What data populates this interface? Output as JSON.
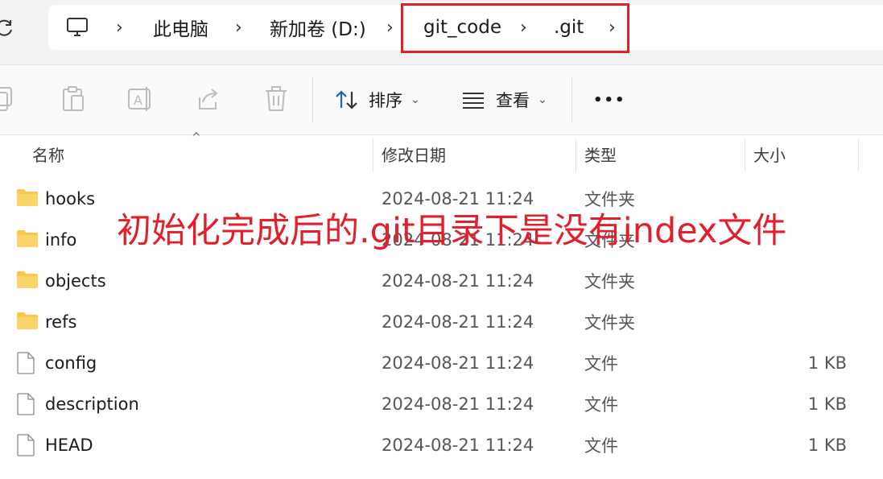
{
  "address_bar": {
    "items": [
      "此电脑",
      "新加卷 (D:)",
      "git_code",
      ".git"
    ],
    "computer_icon": "computer-icon",
    "refresh_icon": "refresh-icon"
  },
  "toolbar": {
    "sort_label": "排序",
    "view_label": "查看",
    "more_label": "•••"
  },
  "columns": {
    "name": "名称",
    "date_modified": "修改日期",
    "type": "类型",
    "size": "大小"
  },
  "files": [
    {
      "name": "hooks",
      "date": "2024-08-21 11:24",
      "type": "文件夹",
      "size": "",
      "icon": "folder-icon"
    },
    {
      "name": "info",
      "date": "2024-08-21 11:24",
      "type": "文件夹",
      "size": "",
      "icon": "folder-icon"
    },
    {
      "name": "objects",
      "date": "2024-08-21 11:24",
      "type": "文件夹",
      "size": "",
      "icon": "folder-icon"
    },
    {
      "name": "refs",
      "date": "2024-08-21 11:24",
      "type": "文件夹",
      "size": "",
      "icon": "folder-icon"
    },
    {
      "name": "config",
      "date": "2024-08-21 11:24",
      "type": "文件",
      "size": "1 KB",
      "icon": "file-icon"
    },
    {
      "name": "description",
      "date": "2024-08-21 11:24",
      "type": "文件",
      "size": "1 KB",
      "icon": "file-icon"
    },
    {
      "name": "HEAD",
      "date": "2024-08-21 11:24",
      "type": "文件",
      "size": "1 KB",
      "icon": "file-icon"
    }
  ],
  "annotation": "初始化完成后的.git目录下是没有index文件",
  "colors": {
    "highlight": "#e1202b",
    "folder": "#f8c84a",
    "accent": "#1f5fbf"
  }
}
